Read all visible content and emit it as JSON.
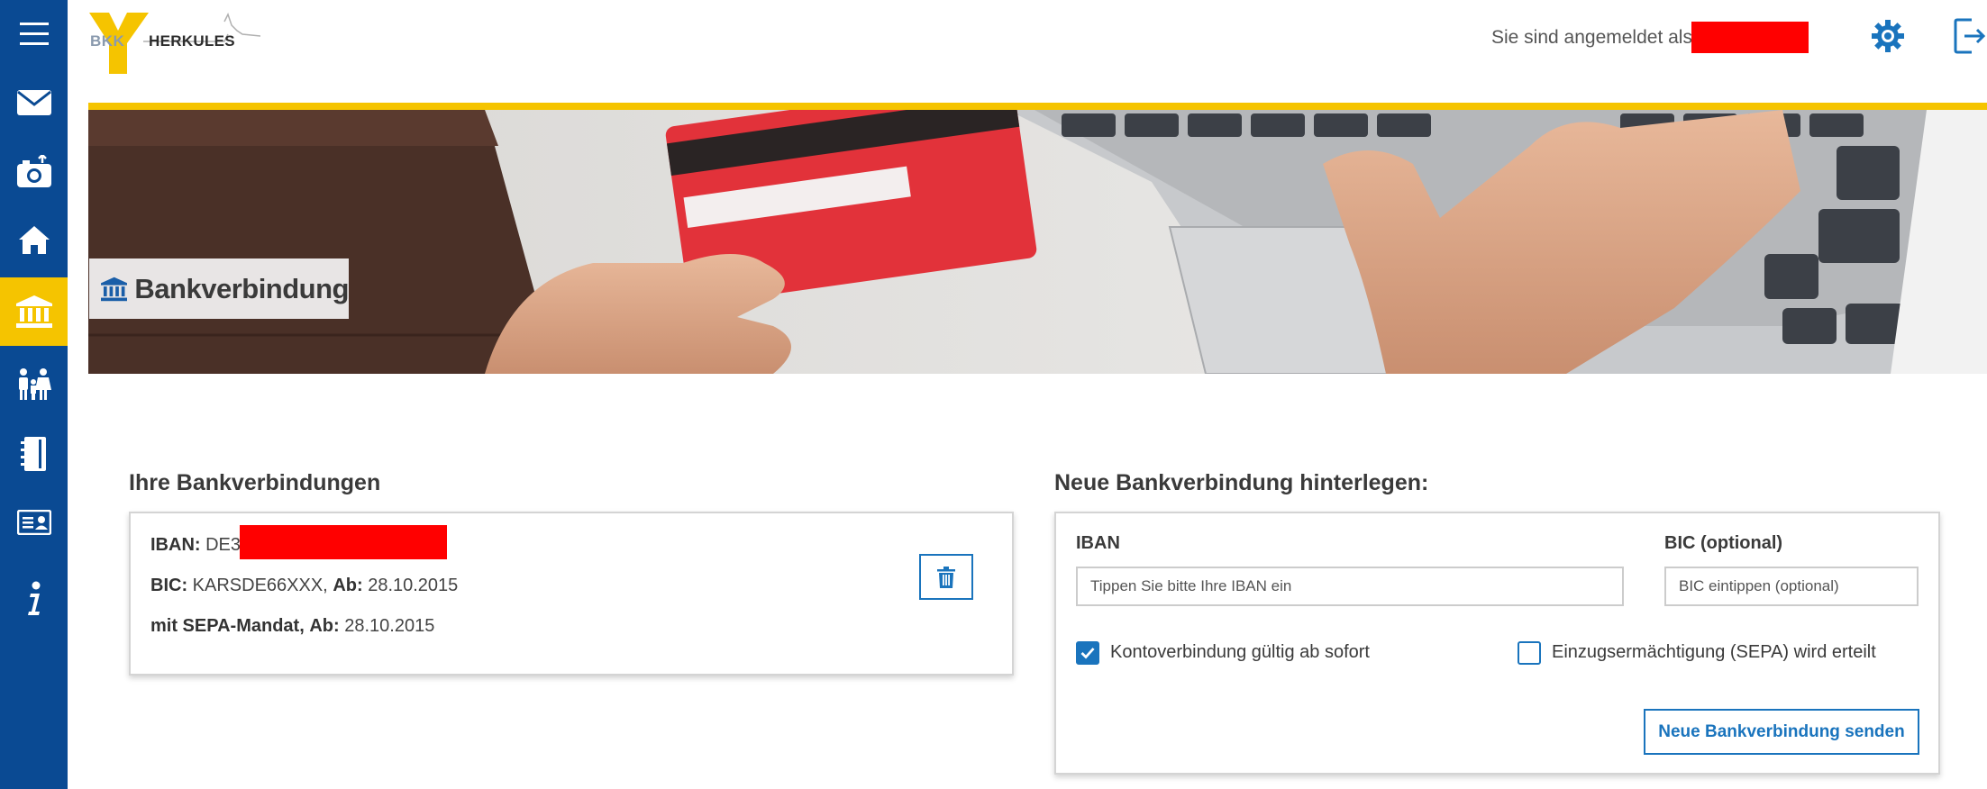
{
  "sidebar": {
    "items": [
      {
        "icon": "menu-icon"
      },
      {
        "icon": "mail-icon"
      },
      {
        "icon": "camera-upload-icon"
      },
      {
        "icon": "home-icon"
      },
      {
        "icon": "bank-icon",
        "active": true
      },
      {
        "icon": "family-icon"
      },
      {
        "icon": "notebook-icon"
      },
      {
        "icon": "id-card-icon"
      },
      {
        "icon": "info-icon"
      }
    ],
    "bg_color": "#0a4a93",
    "active_color": "#f5c400"
  },
  "header": {
    "logo_bkk": "BKK",
    "logo_name": "HERKULES",
    "login_label": "Sie sind angemeldet als:",
    "settings_icon": "gear-icon",
    "logout_icon": "logout-icon"
  },
  "banner": {
    "title": "Bankverbindung",
    "icon": "bank-icon"
  },
  "accounts": {
    "title": "Ihre Bankverbindungen",
    "iban_label": "IBAN:",
    "iban_value": "DE30",
    "bic_label": "BIC:",
    "bic_value": "KARSDE66XXX,",
    "from_label": "Ab:",
    "from_value": "28.10.2015",
    "sepa_label": "mit SEPA-Mandat,",
    "sepa_from_label": "Ab:",
    "sepa_from_value": "28.10.2015",
    "delete_icon": "trash-icon"
  },
  "new_account": {
    "title": "Neue Bankverbindung hinterlegen:",
    "iban_label": "IBAN",
    "iban_placeholder": "Tippen Sie bitte Ihre IBAN ein",
    "bic_label": "BIC (optional)",
    "bic_placeholder": "BIC eintippen (optional)",
    "check_valid_label": "Kontoverbindung gültig ab sofort",
    "check_valid_checked": true,
    "check_sepa_label": "Einzugsermächtigung (SEPA) wird erteilt",
    "check_sepa_checked": false,
    "submit_label": "Neue Bankverbindung senden"
  },
  "colors": {
    "accent": "#1a74bd",
    "brand_yellow": "#f5c400",
    "brand_blue": "#0a4a93",
    "redaction": "#ff0000"
  }
}
